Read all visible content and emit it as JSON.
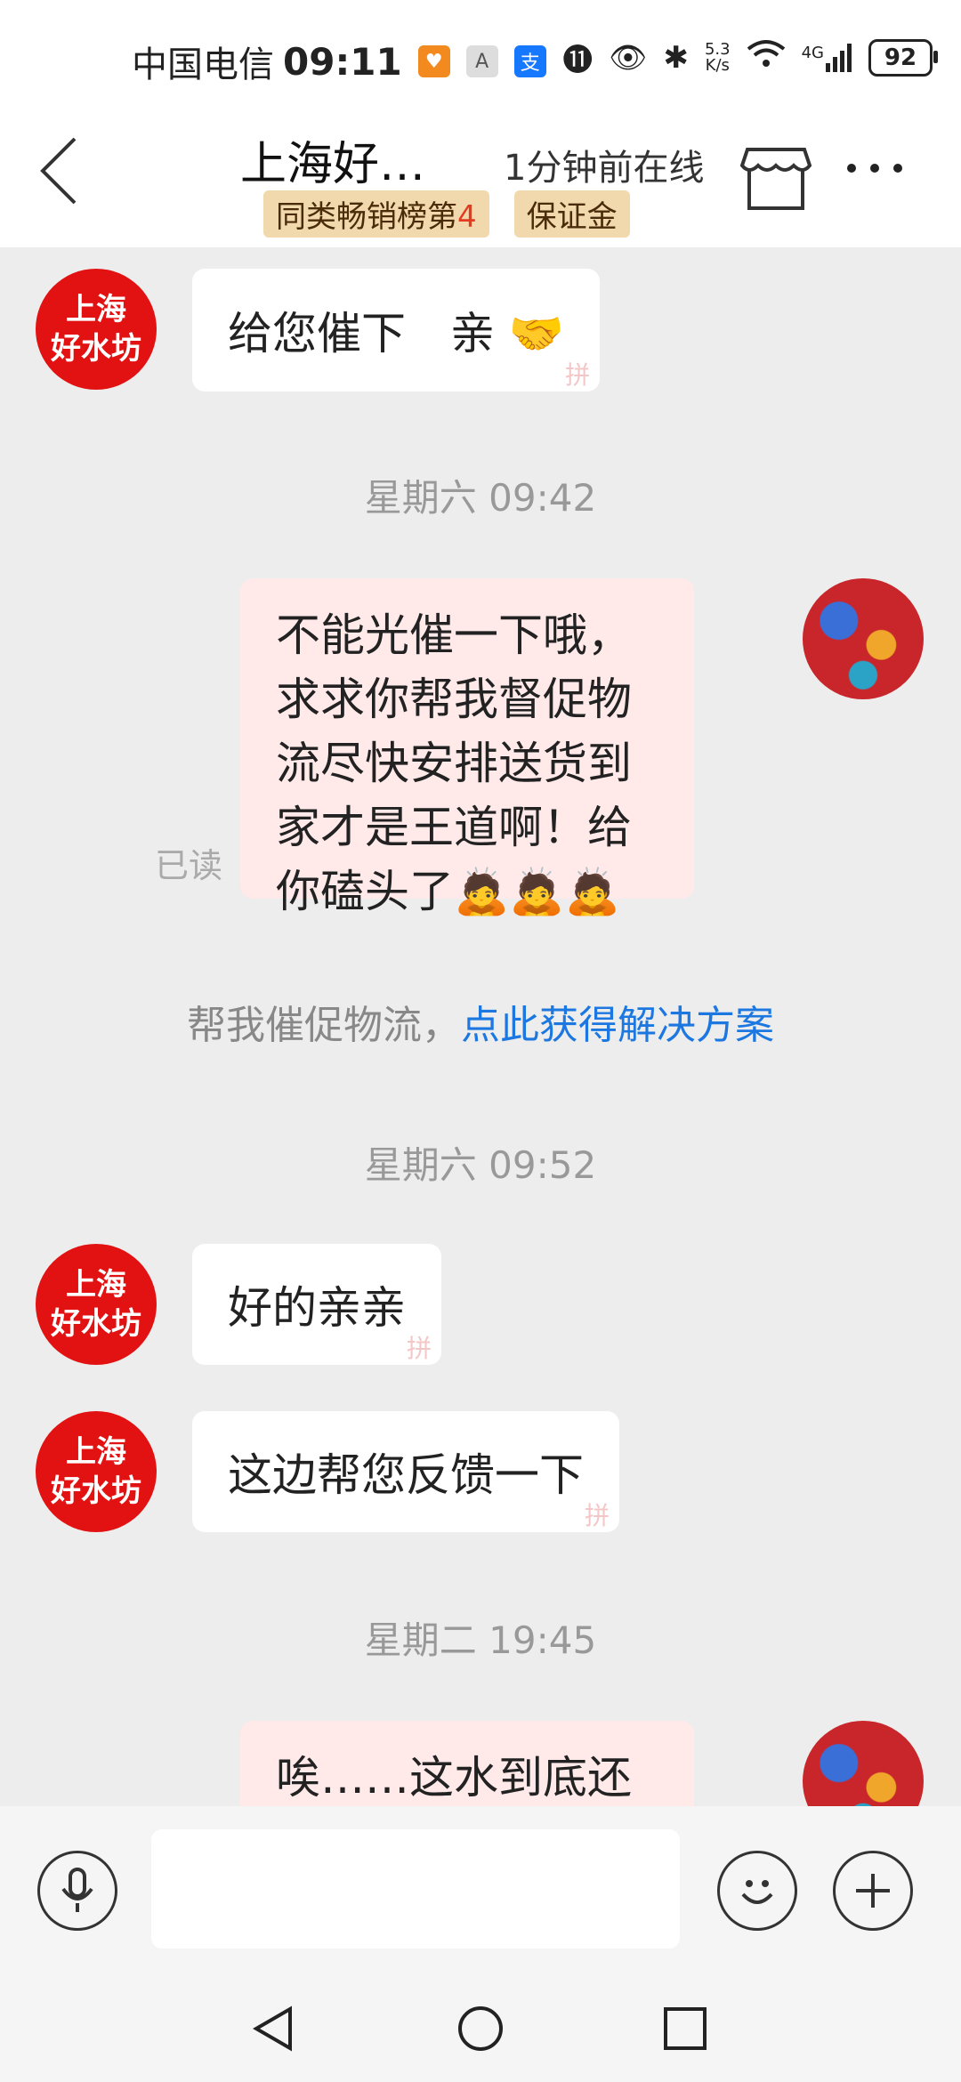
{
  "status_bar": {
    "carrier": "中国电信",
    "time": "09:11",
    "speed_value": "5.3",
    "speed_unit": "K/s",
    "network": "4G",
    "battery": "92"
  },
  "header": {
    "title": "上海好…",
    "online_status": "1分钟前在线",
    "badge_rank_prefix": "同类畅销榜第",
    "badge_rank_number": "4",
    "badge_deposit": "保证金"
  },
  "shop_avatar": {
    "line1": "上海",
    "line2": "好水坊"
  },
  "messages": [
    {
      "id": "m1",
      "from": "shop",
      "text": "给您催下　亲 🤝"
    },
    {
      "id": "t1",
      "type": "timestamp",
      "text": "星期六 09:42"
    },
    {
      "id": "m2",
      "from": "me",
      "text": "不能光催一下哦，求求你帮我督促物流尽快安排送货到家才是王道啊！给你磕头了🙇🙇🙇",
      "read_label": "已读"
    },
    {
      "id": "h1",
      "type": "hint",
      "prefix": "帮我催促物流，",
      "link": "点此获得解决方案"
    },
    {
      "id": "t2",
      "type": "timestamp",
      "text": "星期六 09:52"
    },
    {
      "id": "m3",
      "from": "shop",
      "text": "好的亲亲"
    },
    {
      "id": "m4",
      "from": "shop",
      "text": "这边帮您反馈一下"
    },
    {
      "id": "t3",
      "type": "timestamp",
      "text": "星期二 19:45"
    },
    {
      "id": "m5",
      "from": "me",
      "text": "唉……这水到底还能"
    }
  ],
  "watermark": "拼",
  "colors": {
    "accent_blue": "#1c78e0",
    "shop_avatar_red": "#e31212",
    "outgoing_bubble": "#ffe9e9",
    "badge_bg": "#f1d9ad"
  }
}
